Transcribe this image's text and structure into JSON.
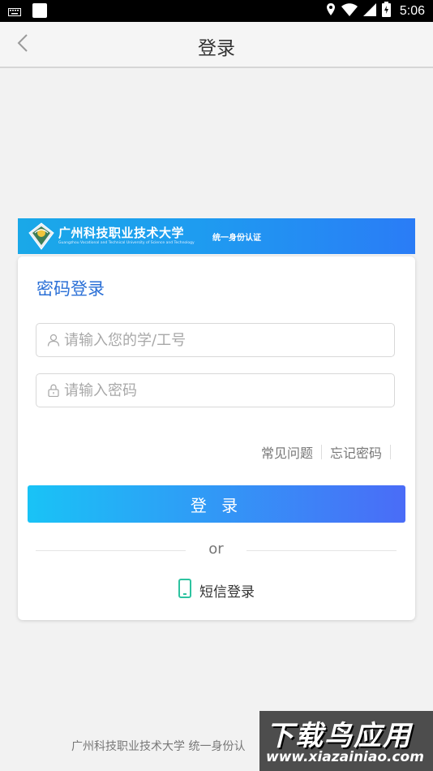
{
  "status_bar": {
    "time": "5:06",
    "icons": [
      "keyboard-icon",
      "app-square-icon",
      "location-icon",
      "wifi-icon",
      "signal-icon",
      "battery-icon"
    ]
  },
  "app_bar": {
    "title": "登录",
    "back_icon": "chevron-left-icon"
  },
  "banner": {
    "school_name": "广州科技职业技术大学",
    "english_name": "Guangzhou Vocational and Technical University of Science and Technology",
    "system_name": "统一身份认证"
  },
  "login_card": {
    "title": "密码登录",
    "username": {
      "value": "",
      "placeholder": "请输入您的学/工号",
      "icon": "user-icon"
    },
    "password": {
      "value": "",
      "placeholder": "请输入密码",
      "icon": "lock-icon"
    },
    "links": {
      "faq": "常见问题",
      "forgot_password": "忘记密码"
    },
    "login_button": "登 录",
    "divider_text": "or",
    "sms_login": {
      "label": "短信登录",
      "icon": "phone-icon"
    }
  },
  "footer": {
    "text": "广州科技职业技术大学 统一身份认"
  },
  "watermark": {
    "title": "下载鸟应用",
    "url": "www.xiazainiao.com"
  },
  "colors": {
    "accent": "#2a6fd6",
    "button_start": "#19c3f6",
    "button_end": "#4a6cf7",
    "sms_icon": "#2dc3a0",
    "background": "#f2f2f2"
  }
}
